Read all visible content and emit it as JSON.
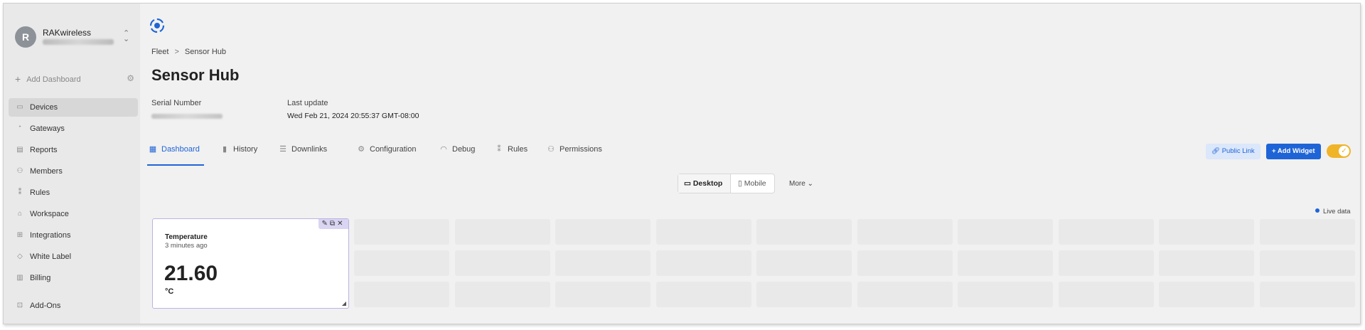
{
  "org": {
    "avatar_letter": "R",
    "name": "RAKwireless"
  },
  "sidebar": {
    "add_dashboard": "Add Dashboard",
    "items": [
      {
        "label": "Devices",
        "icon": "device-icon",
        "glyph": "▭",
        "active": true
      },
      {
        "label": "Gateways",
        "icon": "gateway-icon",
        "glyph": "ᐩ"
      },
      {
        "label": "Reports",
        "icon": "report-icon",
        "glyph": "▤"
      },
      {
        "label": "Members",
        "icon": "members-icon",
        "glyph": "⚇"
      },
      {
        "label": "Rules",
        "icon": "rules-icon",
        "glyph": "⁑"
      },
      {
        "label": "Workspace",
        "icon": "workspace-icon",
        "glyph": "⌂"
      },
      {
        "label": "Integrations",
        "icon": "integrations-icon",
        "glyph": "⊞"
      },
      {
        "label": "White Label",
        "icon": "tag-icon",
        "glyph": "◇"
      },
      {
        "label": "Billing",
        "icon": "billing-icon",
        "glyph": "▥"
      },
      {
        "label": "Add-Ons",
        "icon": "addons-icon",
        "glyph": "⊡"
      }
    ]
  },
  "breadcrumb": {
    "root": "Fleet",
    "separator": ">",
    "current": "Sensor Hub"
  },
  "page_title": "Sensor Hub",
  "meta": {
    "serial_label": "Serial Number",
    "update_label": "Last update",
    "update_value": "Wed Feb 21, 2024 20:55:37 GMT-08:00"
  },
  "tabs": [
    {
      "label": "Dashboard",
      "icon": "dashboard-icon",
      "glyph": "▦",
      "active": true
    },
    {
      "label": "History",
      "icon": "history-icon",
      "glyph": "▮"
    },
    {
      "label": "Downlinks",
      "icon": "downlinks-icon",
      "glyph": "☰"
    },
    {
      "label": "Configuration",
      "icon": "configuration-icon",
      "glyph": "⚙"
    },
    {
      "label": "Debug",
      "icon": "debug-icon",
      "glyph": "◠"
    },
    {
      "label": "Rules",
      "icon": "rules-tab-icon",
      "glyph": "⁑"
    },
    {
      "label": "Permissions",
      "icon": "permissions-icon",
      "glyph": "⚇"
    }
  ],
  "actions": {
    "public_link": "Public Link",
    "add_widget": "Add Widget",
    "toggle_on": true
  },
  "view_switch": {
    "desktop": "Desktop",
    "mobile": "Mobile",
    "more": "More"
  },
  "live_data": "Live data",
  "widget": {
    "title": "Temperature",
    "subtitle": "3 minutes ago",
    "value": "21.60",
    "unit": "°C"
  },
  "colors": {
    "accent": "#1f64d6",
    "toggle": "#f0b429",
    "widget_border": "#b9b3e3"
  }
}
